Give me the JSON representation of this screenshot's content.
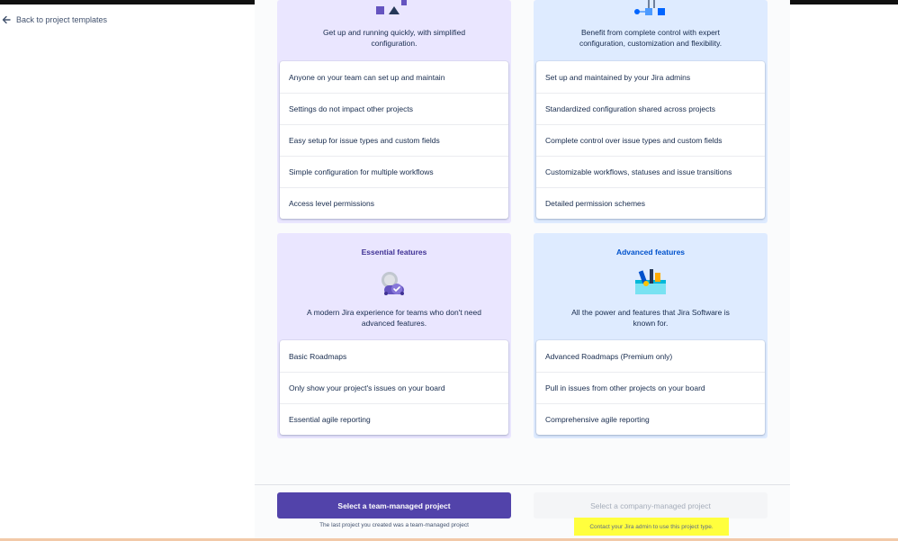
{
  "nav": {
    "back_label": "Back to project templates"
  },
  "team_managed": {
    "description": "Get up and running quickly, with simplified configuration.",
    "items": [
      "Anyone on your team can set up and maintain",
      "Settings do not impact other projects",
      "Easy setup for issue types and custom fields",
      "Simple configuration for multiple workflows",
      "Access level permissions"
    ],
    "features_title": "Essential features",
    "features_description": "A modern Jira experience for teams who don't need advanced features.",
    "features": [
      "Basic Roadmaps",
      "Only show your project's issues on your board",
      "Essential agile reporting"
    ],
    "select_label": "Select a team-managed project",
    "last_project_note": "The last project you created was a team-managed project"
  },
  "company_managed": {
    "description": "Benefit from complete control with expert configuration, customization and flexibility.",
    "items": [
      "Set up and maintained by your Jira admins",
      "Standardized configuration shared across projects",
      "Complete control over issue types and custom fields",
      "Customizable workflows, statuses and issue transitions",
      "Detailed permission schemes"
    ],
    "features_title": "Advanced features",
    "features_description": "All the power and features that Jira Software is known for.",
    "features": [
      "Advanced Roadmaps (Premium only)",
      "Pull in issues from other projects on your board",
      "Comprehensive agile reporting"
    ],
    "select_label": "Select a company-managed project",
    "admin_note": "Contact your Jira admin to use this project type."
  },
  "colors": {
    "team_panel_bg": "#eae6ff",
    "company_panel_bg": "#deebff",
    "primary_button": "#5243aa",
    "highlight": "#ffff3d"
  },
  "icons": {
    "back": "arrow-left-icon",
    "team_top": "shapes-illustration",
    "company_top": "nodes-illustration",
    "essential": "rocket-check-illustration",
    "advanced": "toolbox-illustration"
  }
}
